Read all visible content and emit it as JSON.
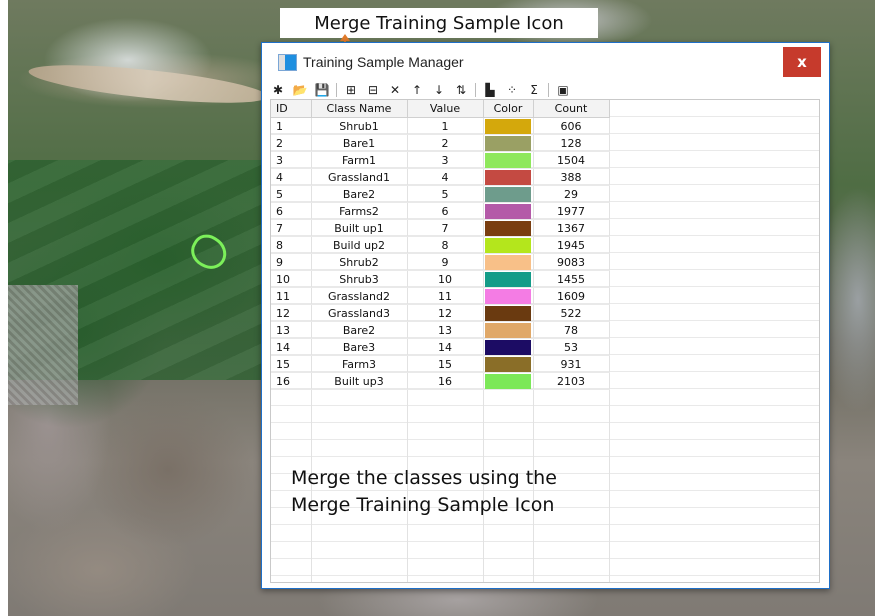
{
  "annotation": {
    "callout_label": "Merge Training Sample Icon",
    "note_line1": "Merge the classes using the",
    "note_line2": "Merge Training Sample Icon",
    "arrow_color": "#e07a2a"
  },
  "window": {
    "title": "Training Sample Manager",
    "close_label": "x",
    "close_color": "#c63a2c"
  },
  "toolbar": [
    {
      "name": "new-sample-icon",
      "glyph": "✱"
    },
    {
      "name": "open-folder-icon",
      "glyph": "📂"
    },
    {
      "name": "save-icon",
      "glyph": "💾"
    },
    {
      "name": "merge-training-sample-icon",
      "glyph": "⊞"
    },
    {
      "name": "split-training-sample-icon",
      "glyph": "⊟"
    },
    {
      "name": "delete-icon",
      "glyph": "✕"
    },
    {
      "name": "move-up-icon",
      "glyph": "↑"
    },
    {
      "name": "move-down-icon",
      "glyph": "↓"
    },
    {
      "name": "sort-icon",
      "glyph": "⇅"
    },
    {
      "name": "histogram-icon",
      "glyph": "▙"
    },
    {
      "name": "scatterplot-icon",
      "glyph": "⁘"
    },
    {
      "name": "statistics-icon",
      "glyph": "Σ"
    },
    {
      "name": "evaluate-icon",
      "glyph": "▣"
    }
  ],
  "table": {
    "headers": [
      "ID",
      "Class Name",
      "Value",
      "Color",
      "Count"
    ],
    "rows": [
      {
        "id": "1",
        "name": "Shrub1",
        "value": "1",
        "color": "#d4a80c",
        "count": "606"
      },
      {
        "id": "2",
        "name": "Bare1",
        "value": "2",
        "color": "#9aa064",
        "count": "128"
      },
      {
        "id": "3",
        "name": "Farm1",
        "value": "3",
        "color": "#8fe85c",
        "count": "1504"
      },
      {
        "id": "4",
        "name": "Grassland1",
        "value": "4",
        "color": "#c44a42",
        "count": "388"
      },
      {
        "id": "5",
        "name": "Bare2",
        "value": "5",
        "color": "#6e9c8c",
        "count": "29"
      },
      {
        "id": "6",
        "name": "Farms2",
        "value": "6",
        "color": "#b45aa8",
        "count": "1977"
      },
      {
        "id": "7",
        "name": "Built up1",
        "value": "7",
        "color": "#7a3e10",
        "count": "1367"
      },
      {
        "id": "8",
        "name": "Build up2",
        "value": "8",
        "color": "#b4e61c",
        "count": "1945"
      },
      {
        "id": "9",
        "name": "Shrub2",
        "value": "9",
        "color": "#f8c088",
        "count": "9083"
      },
      {
        "id": "10",
        "name": "Shrub3",
        "value": "10",
        "color": "#149c88",
        "count": "1455"
      },
      {
        "id": "11",
        "name": "Grassland2",
        "value": "11",
        "color": "#f47ce4",
        "count": "1609"
      },
      {
        "id": "12",
        "name": "Grassland3",
        "value": "12",
        "color": "#6a3a10",
        "count": "522"
      },
      {
        "id": "13",
        "name": "Bare2",
        "value": "13",
        "color": "#e0a868",
        "count": "78"
      },
      {
        "id": "14",
        "name": "Bare3",
        "value": "14",
        "color": "#1c0c64",
        "count": "53"
      },
      {
        "id": "15",
        "name": "Farm3",
        "value": "15",
        "color": "#8a6e28",
        "count": "931"
      },
      {
        "id": "16",
        "name": "Built up3",
        "value": "16",
        "color": "#7ce858",
        "count": "2103"
      }
    ]
  }
}
